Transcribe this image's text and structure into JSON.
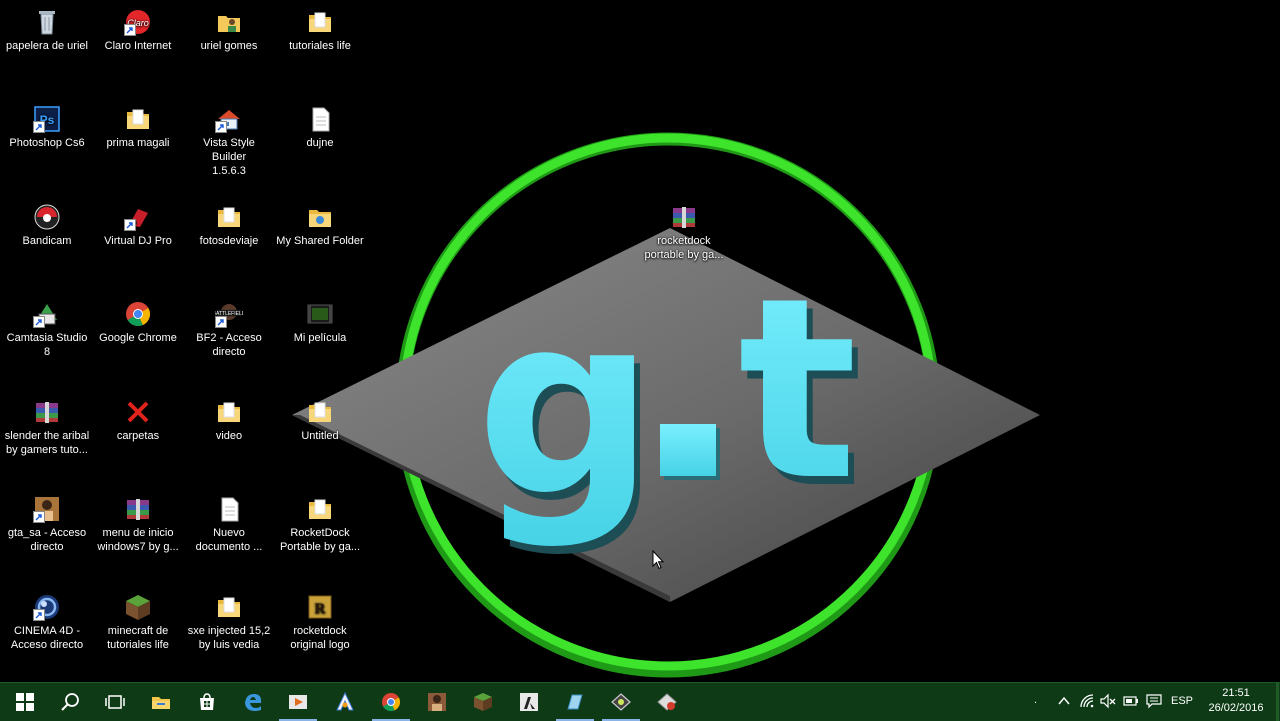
{
  "desktop": {
    "icons": [
      {
        "label": "papelera de uriel",
        "icon": "recycle-bin-icon"
      },
      {
        "label": "Claro Internet",
        "icon": "claro-icon"
      },
      {
        "label": "uriel gomes",
        "icon": "user-folder-icon"
      },
      {
        "label": "tutoriales life",
        "icon": "folder-icon"
      },
      {
        "label": "Photoshop Cs6",
        "icon": "photoshop-icon"
      },
      {
        "label": "prima magali",
        "icon": "folder-icon"
      },
      {
        "label": "Vista Style Builder\n1.5.6.3",
        "icon": "vista-style-builder-icon"
      },
      {
        "label": "dujne",
        "icon": "document-icon"
      },
      {
        "label": "Bandicam",
        "icon": "bandicam-icon"
      },
      {
        "label": "Virtual DJ Pro",
        "icon": "virtual-dj-icon"
      },
      {
        "label": "fotosdeviaje",
        "icon": "folder-icon"
      },
      {
        "label": "My Shared Folder",
        "icon": "shared-folder-icon"
      },
      {
        "label": "rocketdock\nportable by ga...",
        "icon": "winrar-icon"
      },
      {
        "label": "Camtasia Studio\n8",
        "icon": "camtasia-icon"
      },
      {
        "label": "Google Chrome",
        "icon": "chrome-icon"
      },
      {
        "label": "BF2 - Acceso\ndirecto",
        "icon": "battlefield-icon"
      },
      {
        "label": "Mi película",
        "icon": "movie-icon"
      },
      {
        "label": "slender the aribal\nby gamers tuto...",
        "icon": "winrar-icon"
      },
      {
        "label": "carpetas",
        "icon": "red-x-icon"
      },
      {
        "label": "video",
        "icon": "folder-icon"
      },
      {
        "label": "Untitled",
        "icon": "folder-icon"
      },
      {
        "label": "gta_sa - Acceso\ndirecto",
        "icon": "gta-icon"
      },
      {
        "label": "menu de inicio\nwindows7 by g...",
        "icon": "winrar-icon"
      },
      {
        "label": "Nuevo\ndocumento ...",
        "icon": "document-icon"
      },
      {
        "label": "RocketDock\nPortable by ga...",
        "icon": "folder-icon"
      },
      {
        "label": "CINEMA 4D -\nAcceso directo",
        "icon": "cinema4d-icon"
      },
      {
        "label": "minecraft de\ntutoriales life",
        "icon": "minecraft-icon"
      },
      {
        "label": "sxe injected 15,2\nby luis vedia",
        "icon": "folder-icon"
      },
      {
        "label": "rocketdock\noriginal logo",
        "icon": "rocketdock-icon"
      }
    ],
    "wallpaper_text": "g·t"
  },
  "taskbar": {
    "buttons": [
      "start-button",
      "search-button",
      "task-view-button",
      "file-explorer-button",
      "store-button",
      "edge-button",
      "media-player-button",
      "avast-button",
      "chrome-button",
      "gta-button",
      "minecraft-button",
      "cs-button",
      "vista-builder-button",
      "vdj-button",
      "winrar-button"
    ],
    "language": "ESP",
    "time": "21:51",
    "date": "26/02/2016"
  },
  "colors": {
    "taskbar": "#0e3b16",
    "ring": "#2bd11e",
    "letters": "#5ce6f5",
    "diamond": "#6e6e6e"
  }
}
